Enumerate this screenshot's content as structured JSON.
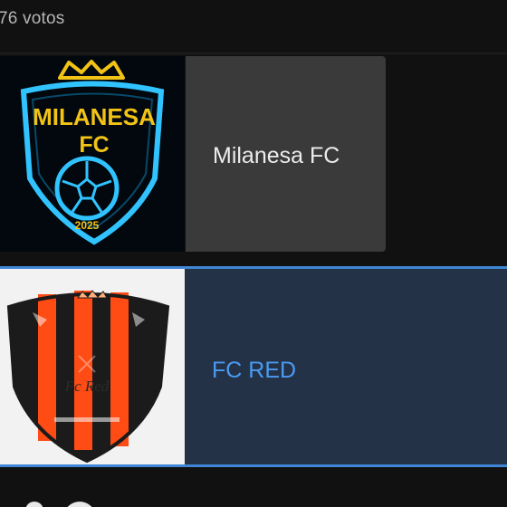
{
  "poll": {
    "votes_label": "76 votos"
  },
  "options": [
    {
      "label": "Milanesa FC",
      "logo_text": "MILANESA",
      "logo_sub": "FC",
      "logo_year": "2025",
      "selected": false
    },
    {
      "label": "FC RED",
      "logo_text": "Fc Red",
      "selected": true
    }
  ],
  "colors": {
    "background": "#111111",
    "option_label_bg": "#3a3a3a",
    "selected_bg": "#243248",
    "selected_accent": "#3f86d6",
    "selected_text": "#4a9bf1",
    "milanesa_gold": "#f2c316",
    "milanesa_cyan": "#39c7ff",
    "fcred_orange": "#ff4b14"
  },
  "icons": {
    "milanesa": "milanesa-fc-crest",
    "fcred": "fc-red-crest"
  }
}
